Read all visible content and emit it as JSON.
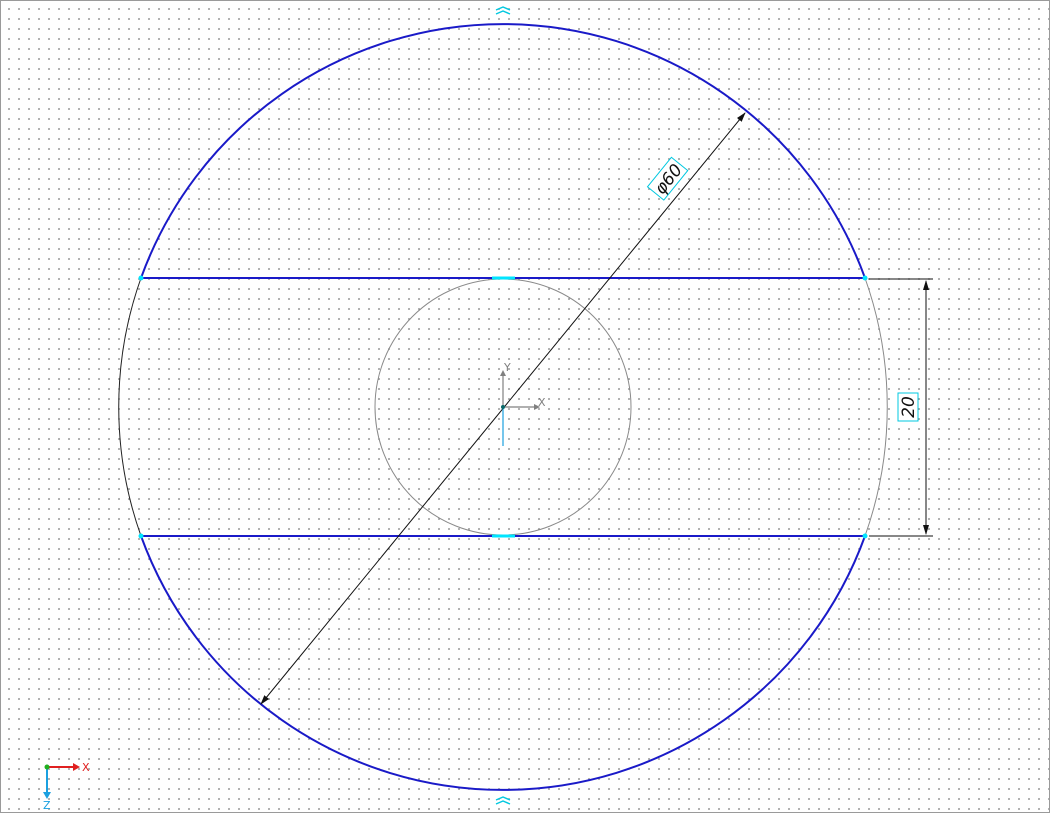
{
  "window": {
    "title": ""
  },
  "colors": {
    "contour": "#1a1ac8",
    "construction": "#8a8a8a",
    "thin_edge": "#222222",
    "dimension": "#111111",
    "highlight": "#00e5ff",
    "axis_x": "#e02020",
    "axis_y": "#808080",
    "axis_z": "#1aa0e0",
    "origin_green": "#20b020"
  },
  "sketch": {
    "diameter_dimension": {
      "label": "φ60",
      "icon": "diameter-dimension"
    },
    "linear_dimension": {
      "label": "20",
      "icon": "linear-dimension"
    },
    "local_axes": {
      "x_label": "X",
      "y_label": "Y"
    },
    "symmetry_markers": {
      "icon": "tangent-constraint-icon"
    }
  },
  "view_triad": {
    "x_label": "X",
    "z_label": "Z"
  }
}
